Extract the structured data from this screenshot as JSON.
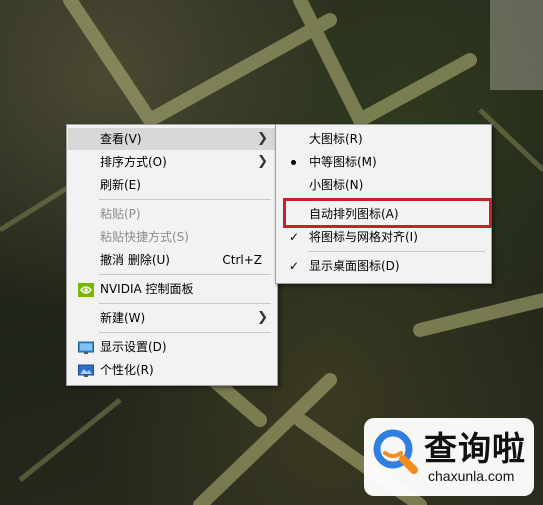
{
  "context_menu": {
    "items": [
      {
        "label": "查看(V)",
        "has_submenu": true,
        "highlighted": true
      },
      {
        "label": "排序方式(O)",
        "has_submenu": true
      },
      {
        "label": "刷新(E)"
      },
      {
        "label": "粘贴(P)",
        "disabled": true
      },
      {
        "label": "粘贴快捷方式(S)",
        "disabled": true
      },
      {
        "label": "撤消 删除(U)",
        "shortcut": "Ctrl+Z"
      },
      {
        "label": "NVIDIA 控制面板",
        "icon": "nvidia-icon"
      },
      {
        "label": "新建(W)",
        "has_submenu": true
      },
      {
        "label": "显示设置(D)",
        "icon": "display-settings-icon"
      },
      {
        "label": "个性化(R)",
        "icon": "personalize-icon"
      }
    ]
  },
  "view_submenu": {
    "items": [
      {
        "label": "大图标(R)"
      },
      {
        "label": "中等图标(M)",
        "selected": true
      },
      {
        "label": "小图标(N)"
      },
      {
        "label": "自动排列图标(A)",
        "outlined": true
      },
      {
        "label": "将图标与网格对齐(I)",
        "checked": true
      },
      {
        "label": "显示桌面图标(D)",
        "checked": true
      }
    ]
  },
  "watermark": {
    "title": "查询啦",
    "url": "chaxunla.com"
  },
  "colors": {
    "menu_bg": "#f2f2f2",
    "highlight_bg": "#d8d8d8",
    "outline": "#c81f29",
    "brand_blue": "#2f7fe0",
    "brand_orange": "#f28c1a"
  }
}
